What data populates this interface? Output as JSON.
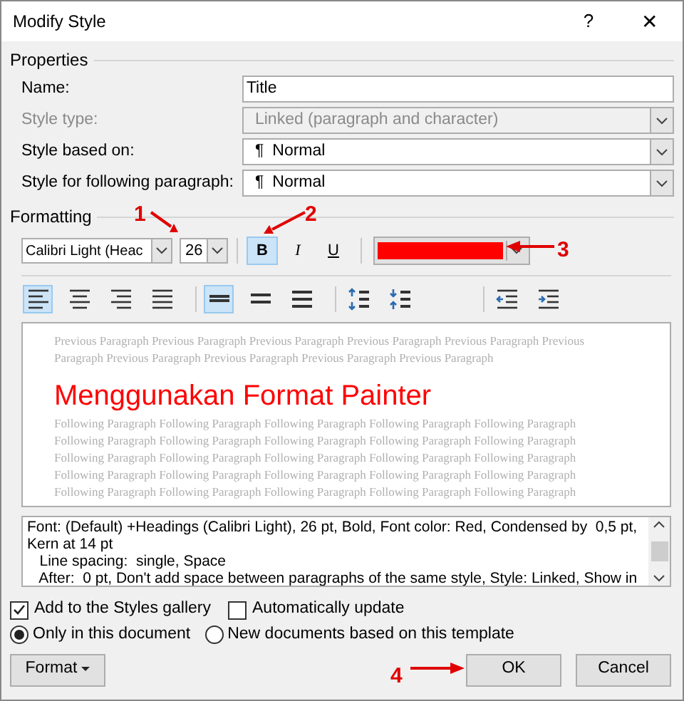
{
  "window": {
    "title": "Modify Style",
    "help": "?",
    "close": "✕"
  },
  "properties": {
    "heading": "Properties",
    "fields": [
      {
        "label": "Name:",
        "value": "Title",
        "kind": "text",
        "disabled": false
      },
      {
        "label": "Style type:",
        "value": "Linked (paragraph and character)",
        "kind": "select",
        "disabled": true
      },
      {
        "label": "Style based on:",
        "value": "Normal",
        "mark": "¶",
        "kind": "select",
        "disabled": false
      },
      {
        "label": "Style for following paragraph:",
        "value": "Normal",
        "mark": "¶",
        "kind": "select",
        "disabled": false
      }
    ]
  },
  "formatting": {
    "heading": "Formatting",
    "font": "Calibri Light (Heac",
    "size": "26",
    "styles": [
      {
        "label": "B",
        "kind": "bold",
        "selected": true
      },
      {
        "label": "I",
        "kind": "italic",
        "selected": false
      },
      {
        "label": "U",
        "kind": "underline",
        "selected": false
      }
    ],
    "color": "#ff0000",
    "paragraph_buttons": [
      {
        "kind": "align-left",
        "selected": true
      },
      {
        "kind": "align-center",
        "selected": false
      },
      {
        "kind": "align-right",
        "selected": false
      },
      {
        "kind": "justify",
        "selected": false
      },
      {
        "kind": "spacing-single",
        "selected": true
      },
      {
        "kind": "spacing-1-5",
        "selected": false
      },
      {
        "kind": "spacing-double",
        "selected": false
      },
      {
        "kind": "space-increase",
        "selected": false
      },
      {
        "kind": "space-decrease",
        "selected": false
      },
      {
        "kind": "indent-decrease",
        "selected": false
      },
      {
        "kind": "indent-increase",
        "selected": false
      }
    ]
  },
  "preview": {
    "previous": [
      "Previous Paragraph Previous Paragraph Previous Paragraph Previous Paragraph Previous Paragraph Previous",
      "Paragraph Previous Paragraph Previous Paragraph Previous Paragraph Previous Paragraph"
    ],
    "sample": "Menggunakan Format Painter",
    "following": [
      "Following Paragraph Following Paragraph Following Paragraph Following Paragraph Following Paragraph",
      "Following Paragraph Following Paragraph Following Paragraph Following Paragraph Following Paragraph",
      "Following Paragraph Following Paragraph Following Paragraph Following Paragraph Following Paragraph",
      "Following Paragraph Following Paragraph Following Paragraph Following Paragraph Following Paragraph",
      "Following Paragraph Following Paragraph Following Paragraph Following Paragraph Following Paragraph"
    ]
  },
  "description": [
    "Font: (Default) +Headings (Calibri Light), 26 pt, Bold, Font color: Red, Condensed by  0,5 pt,",
    "Kern at 14 pt",
    "   Line spacing:  single, Space",
    "   After:  0 pt, Don't add space between paragraphs of the same style, Style: Linked, Show in"
  ],
  "options": {
    "checkboxes": [
      {
        "label": "Add to the Styles gallery",
        "checked": true
      },
      {
        "label": "Automatically update",
        "checked": false
      }
    ],
    "radios": [
      {
        "label": "Only in this document",
        "selected": true
      },
      {
        "label": "New documents based on this template",
        "selected": false
      }
    ]
  },
  "buttons": {
    "format": "Format",
    "ok": "OK",
    "cancel": "Cancel"
  },
  "annotations": [
    "1",
    "2",
    "3",
    "4"
  ]
}
